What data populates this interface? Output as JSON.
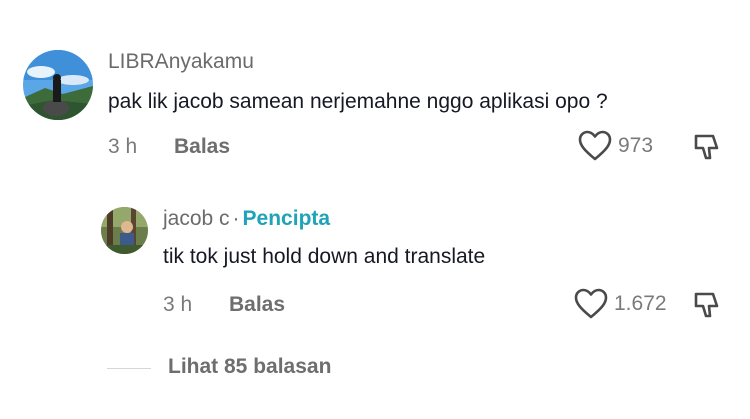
{
  "comments": [
    {
      "username": "LIBRAnyakamu",
      "text": "pak lik jacob samean nerjemahne nggo aplikasi opo ?",
      "time": "3 h",
      "reply_label": "Balas",
      "likes": "973"
    }
  ],
  "reply": {
    "username": "jacob c",
    "separator": "·",
    "badge": "Pencipta",
    "text": "tik tok just hold down and translate",
    "time": "3 h",
    "reply_label": "Balas",
    "likes": "1.672"
  },
  "view_more_label": "Lihat 85 balasan",
  "icons": {
    "like": "heart-outline-icon",
    "dislike": "thumbs-down-icon"
  },
  "colors": {
    "creator_badge": "#1fa3b8",
    "text": "#161823",
    "muted": "#6b6b6b"
  }
}
